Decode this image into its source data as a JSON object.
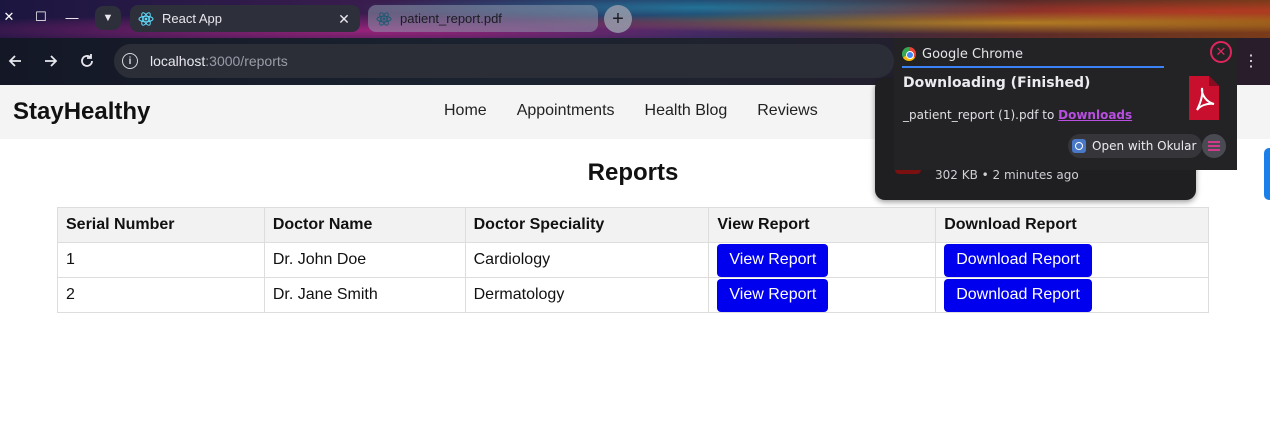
{
  "browser": {
    "tabs": [
      {
        "title": "React App",
        "active": true
      },
      {
        "title": "patient_report.pdf",
        "active": false
      }
    ],
    "url_host": "localhost",
    "url_path": ":3000/reports"
  },
  "site": {
    "logo": "StayHealthy",
    "nav": [
      "Home",
      "Appointments",
      "Health Blog",
      "Reviews"
    ]
  },
  "page": {
    "title": "Reports",
    "table": {
      "headers": [
        "Serial Number",
        "Doctor Name",
        "Doctor Speciality",
        "View Report",
        "Download Report"
      ],
      "rows": [
        {
          "serial": "1",
          "doctor": "Dr. John Doe",
          "speciality": "Cardiology",
          "view": "View Report",
          "download": "Download Report"
        },
        {
          "serial": "2",
          "doctor": "Dr. Jane Smith",
          "speciality": "Dermatology",
          "view": "View Report",
          "download": "Download Report"
        }
      ]
    },
    "button_color": "#0000ee"
  },
  "download_bubble": {
    "meta": "302 KB • 2 minutes ago"
  },
  "notification": {
    "app_name": "Google Chrome",
    "title": "Downloading (Finished)",
    "body_prefix": "_patient_report (1).pdf to ",
    "body_link": "Downloads",
    "action_label": "Open with Okular",
    "accent": "#3b82f6",
    "close_color": "#e0245e"
  }
}
